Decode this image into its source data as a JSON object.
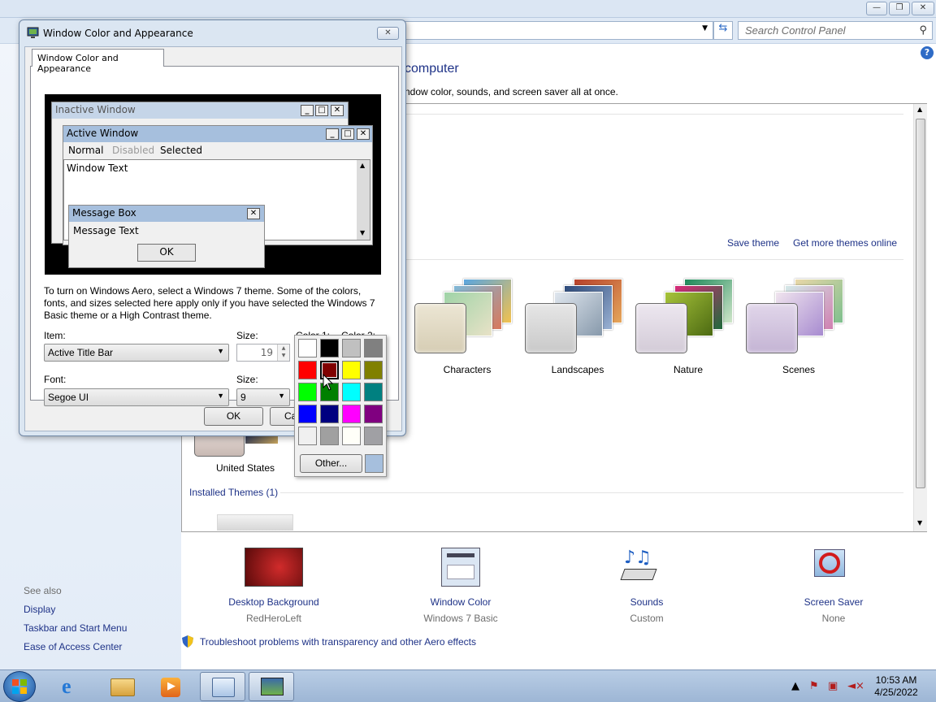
{
  "control_panel": {
    "search_placeholder": "Search Control Panel",
    "heading": "computer",
    "subheading": "ndow color, sounds, and screen saver all at once.",
    "save_theme": "Save theme",
    "get_more_themes": "Get more themes online",
    "themes": [
      {
        "label": "Characters"
      },
      {
        "label": "Landscapes"
      },
      {
        "label": "Nature"
      },
      {
        "label": "Scenes"
      }
    ],
    "country_theme": "United States",
    "installed_themes": "Installed Themes (1)",
    "bottom": [
      {
        "title": "Desktop Background",
        "sub": "RedHeroLeft"
      },
      {
        "title": "Window Color",
        "sub": "Windows 7 Basic"
      },
      {
        "title": "Sounds",
        "sub": "Custom"
      },
      {
        "title": "Screen Saver",
        "sub": "None"
      }
    ],
    "troubleshoot": "Troubleshoot problems with transparency and other Aero effects",
    "see_also": {
      "title": "See also",
      "links": [
        "Display",
        "Taskbar and Start Menu",
        "Ease of Access Center"
      ]
    }
  },
  "dialog": {
    "title": "Window Color and Appearance",
    "tab": "Window Color and Appearance",
    "preview": {
      "inactive_window": "Inactive Window",
      "active_window": "Active Window",
      "menu_normal": "Normal",
      "menu_disabled": "Disabled",
      "menu_selected": "Selected",
      "window_text": "Window Text",
      "message_box": "Message Box",
      "message_text": "Message Text",
      "ok": "OK"
    },
    "info": "To turn on Windows Aero, select a Windows 7 theme.  Some of the colors, fonts, and sizes selected here apply only if you have selected the Windows 7 Basic theme or a High Contrast theme.",
    "item_label": "Item:",
    "item_value": "Active Title Bar",
    "size_label": "Size:",
    "item_size": "19",
    "color1_label": "Color 1:",
    "color2_label": "Color 2:",
    "font_label": "Font:",
    "font_value": "Segoe UI",
    "font_size_label": "Size:",
    "font_size": "9",
    "ok": "OK",
    "cancel_partial": "Ca"
  },
  "picker": {
    "other_label": "Other...",
    "selected": "#800000",
    "current": "#a6bfdd",
    "colors": [
      "#ffffff",
      "#000000",
      "#c0c0c0",
      "#808080",
      "#ff0000",
      "#800000",
      "#ffff00",
      "#808000",
      "#00ff00",
      "#008000",
      "#00ffff",
      "#008080",
      "#0000ff",
      "#000080",
      "#ff00ff",
      "#800080",
      "#f0f0f0",
      "#a0a0a0",
      "#fffff8",
      "#a0a0a4"
    ]
  },
  "colors": {
    "active_title": "#a6bfdd",
    "inactive_title": "#c5d5e8",
    "link": "#1e3287"
  },
  "taskbar": {
    "time": "10:53 AM",
    "date": "4/25/2022"
  }
}
